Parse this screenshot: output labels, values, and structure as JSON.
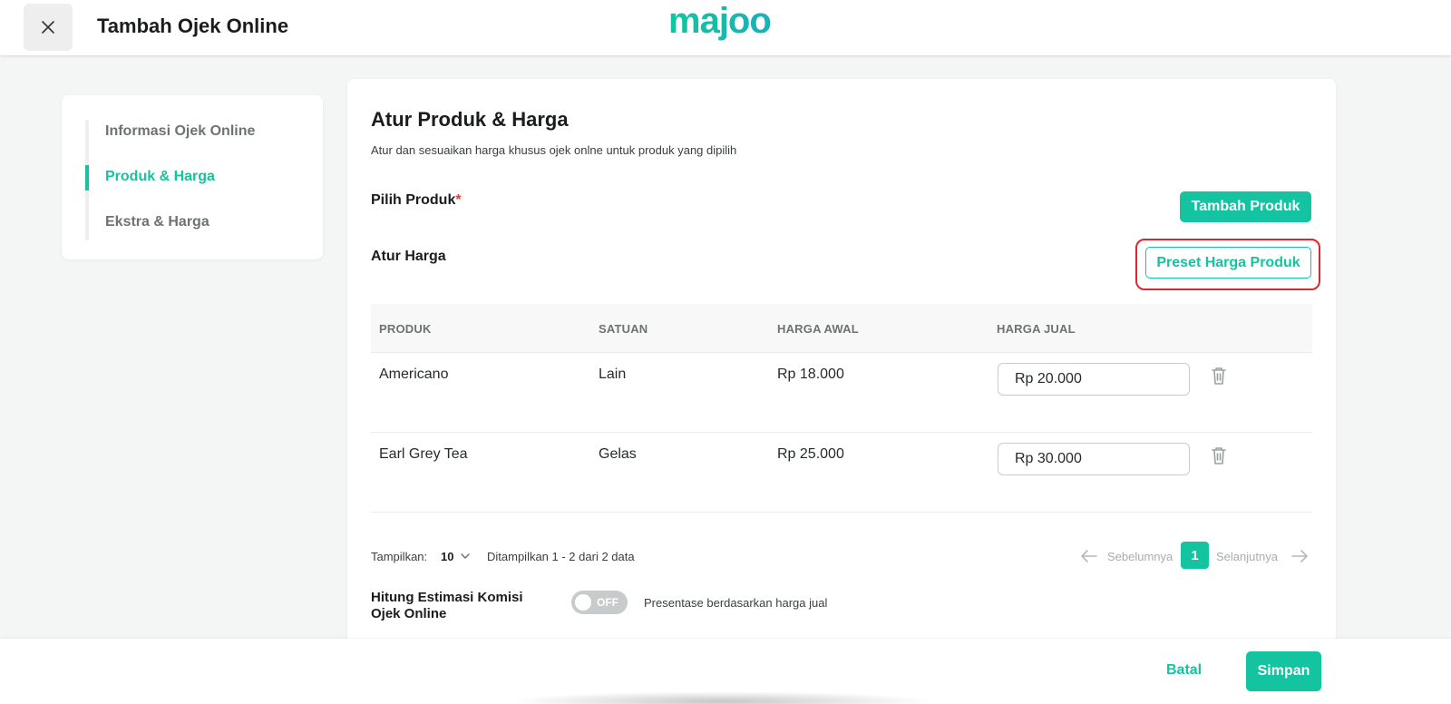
{
  "header": {
    "title": "Tambah Ojek Online",
    "brand": "majoo"
  },
  "sidenav": {
    "items": [
      {
        "label": "Informasi Ojek Online",
        "active": false
      },
      {
        "label": "Produk & Harga",
        "active": true
      },
      {
        "label": "Ekstra & Harga",
        "active": false
      }
    ]
  },
  "main": {
    "title": "Atur Produk & Harga",
    "subtitle": "Atur dan sesuaikan harga khusus ojek onlne untuk produk yang dipilih",
    "pick_product_label": "Pilih Produk",
    "required_mark": "*",
    "set_price_label": "Atur Harga",
    "add_product_button": "Tambah Produk",
    "preset_price_button": "Preset Harga Produk"
  },
  "table": {
    "columns": [
      "PRODUK",
      "SATUAN",
      "HARGA AWAL",
      "HARGA JUAL"
    ],
    "rows": [
      {
        "product": "Americano",
        "unit": "Lain",
        "base_price": "Rp 18.000",
        "sell_price": "Rp 20.000"
      },
      {
        "product": "Earl Grey Tea",
        "unit": "Gelas",
        "base_price": "Rp 25.000",
        "sell_price": "Rp 30.000"
      }
    ]
  },
  "pagination": {
    "show_label": "Tampilkan:",
    "page_size": "10",
    "summary": "Ditampilkan 1 - 2 dari 2 data",
    "prev_label": "Sebelumnya",
    "current_page": "1",
    "next_label": "Selanjutnya"
  },
  "commission": {
    "label": "Hitung Estimasi Komisi Ojek Online",
    "toggle_state": "OFF",
    "description": "Presentase berdasarkan harga jual"
  },
  "footer": {
    "cancel_label": "Batal",
    "save_label": "Simpan"
  },
  "colors": {
    "accent": "#14c4a0",
    "highlight": "#e0262b"
  }
}
